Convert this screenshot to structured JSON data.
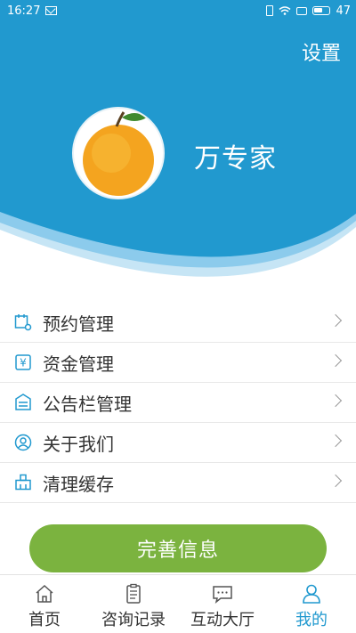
{
  "status_bar": {
    "time": "16:27",
    "battery": "47"
  },
  "header": {
    "settings_label": "设置",
    "username": "万专家"
  },
  "menu": {
    "items": [
      {
        "label": "预约管理",
        "icon": "calendar-settings-icon"
      },
      {
        "label": "资金管理",
        "icon": "yen-wallet-icon"
      },
      {
        "label": "公告栏管理",
        "icon": "notice-board-icon"
      },
      {
        "label": "关于我们",
        "icon": "user-circle-icon"
      },
      {
        "label": "清理缓存",
        "icon": "broom-icon"
      }
    ]
  },
  "complete_button": {
    "label": "完善信息"
  },
  "bottom_nav": {
    "items": [
      {
        "label": "首页",
        "icon": "home-icon"
      },
      {
        "label": "咨询记录",
        "icon": "clipboard-icon"
      },
      {
        "label": "互动大厅",
        "icon": "chat-icon"
      },
      {
        "label": "我的",
        "icon": "person-icon",
        "active": true
      }
    ]
  },
  "colors": {
    "primary_blue": "#2199cf",
    "accent_green": "#7bb33f"
  }
}
